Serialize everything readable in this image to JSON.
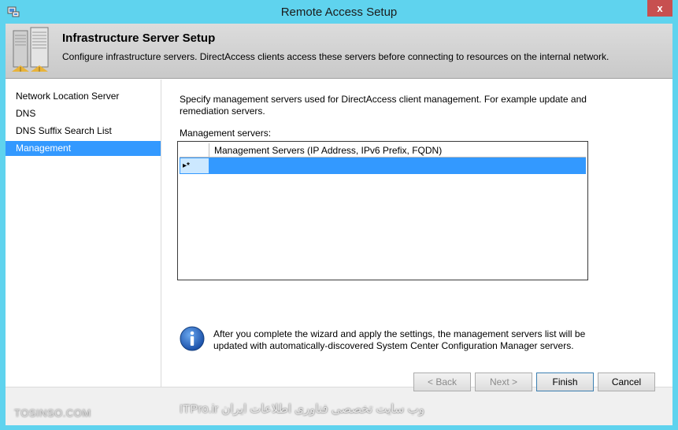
{
  "window": {
    "title": "Remote Access Setup",
    "close_glyph": "x"
  },
  "header": {
    "title": "Infrastructure Server Setup",
    "subtitle": "Configure infrastructure servers. DirectAccess clients access these servers before connecting to resources on the internal network.",
    "icon": "server-rack-icon"
  },
  "nav": {
    "items": [
      {
        "label": "Network Location Server",
        "selected": false
      },
      {
        "label": "DNS",
        "selected": false
      },
      {
        "label": "DNS Suffix Search List",
        "selected": false
      },
      {
        "label": "Management",
        "selected": true
      }
    ]
  },
  "main": {
    "intro": "Specify management servers used for DirectAccess client management. For example update and remediation servers.",
    "grid_label": "Management servers:",
    "grid": {
      "column_header": "Management Servers (IP Address, IPv6 Prefix, FQDN)",
      "new_row_marker": "▸*",
      "rows": []
    },
    "info_text": "After you complete the wizard and apply the settings, the management servers list will be updated with automatically-discovered System Center Configuration Manager servers.",
    "info_icon": "info-icon"
  },
  "footer": {
    "back_label": "< Back",
    "next_label": "Next >",
    "finish_label": "Finish",
    "cancel_label": "Cancel"
  },
  "watermark": {
    "left": "TOSINSO.COM",
    "right": "وب سایت تخصصی فناوری اطلاعات ایران ITPro.ir"
  },
  "colors": {
    "title_bar": "#5fd3ee",
    "selection": "#3399ff",
    "close_button": "#c75050"
  }
}
